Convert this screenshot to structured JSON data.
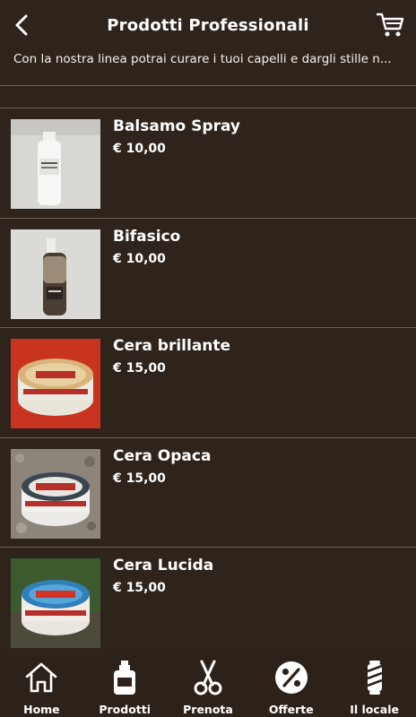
{
  "header": {
    "title": "Prodotti Professionali",
    "back_icon": "chevron-left-icon",
    "cart_icon": "cart-icon"
  },
  "description": "Con la nostra linea potrai curare i tuoi capelli e dargli stille n...",
  "products": [
    {
      "name": "Balsamo Spray",
      "price": "€ 10,00"
    },
    {
      "name": "Bifasico",
      "price": "€ 10,00"
    },
    {
      "name": "Cera brillante",
      "price": "€ 15,00"
    },
    {
      "name": "Cera Opaca",
      "price": "€ 15,00"
    },
    {
      "name": "Cera Lucida",
      "price": "€ 15,00"
    }
  ],
  "tabbar": {
    "items": [
      {
        "label": "Home",
        "icon": "home-icon"
      },
      {
        "label": "Prodotti",
        "icon": "bottle-icon"
      },
      {
        "label": "Prenota",
        "icon": "scissors-icon"
      },
      {
        "label": "Offerte",
        "icon": "percent-icon"
      },
      {
        "label": "Il locale",
        "icon": "barber-pole-icon"
      }
    ]
  },
  "colors": {
    "background": "#2f241c",
    "divider": "#6a5d53",
    "text": "#ffffff"
  }
}
